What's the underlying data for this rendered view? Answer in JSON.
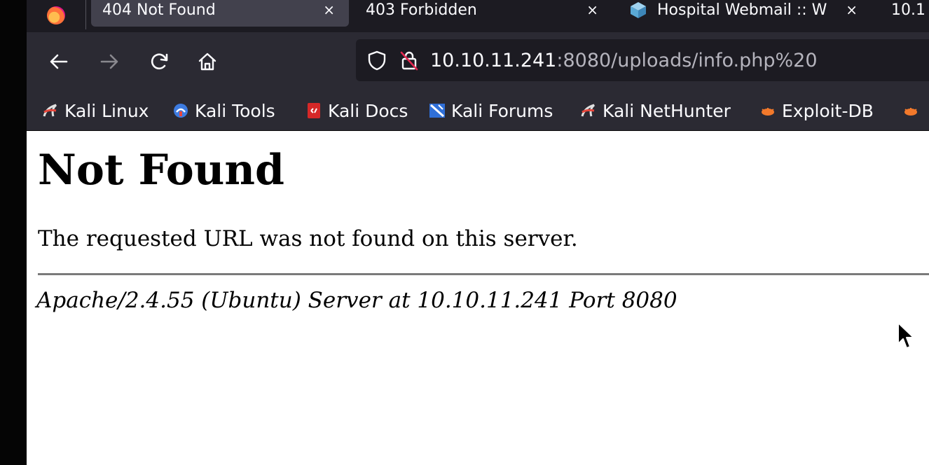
{
  "tabs": [
    {
      "label": "404 Not Found",
      "active": true
    },
    {
      "label": "403 Forbidden",
      "active": false
    },
    {
      "label": "Hospital Webmail :: W",
      "active": false
    },
    {
      "label": "10.1",
      "active": false
    }
  ],
  "tab_close_glyph": "×",
  "url": {
    "host": "10.10.11.241",
    "rest": ":8080/uploads/info.php%20"
  },
  "bookmarks": [
    {
      "label": "Kali Linux",
      "icon": "kali-dragon-icon"
    },
    {
      "label": "Kali Tools",
      "icon": "kali-tools-icon"
    },
    {
      "label": "Kali Docs",
      "icon": "kali-docs-icon"
    },
    {
      "label": "Kali Forums",
      "icon": "kali-forums-icon"
    },
    {
      "label": "Kali NetHunter",
      "icon": "kali-dragon-icon"
    },
    {
      "label": "Exploit-DB",
      "icon": "exploit-db-icon"
    }
  ],
  "page": {
    "title": "Not Found",
    "message": "The requested URL was not found on this server.",
    "signature": "Apache/2.4.55 (Ubuntu) Server at 10.10.11.241 Port 8080"
  },
  "colors": {
    "tabstrip_bg": "#1c1b22",
    "toolbar_bg": "#2b2a33",
    "active_tab_bg": "#42414d",
    "toolbar_text": "#fbfbfe"
  }
}
